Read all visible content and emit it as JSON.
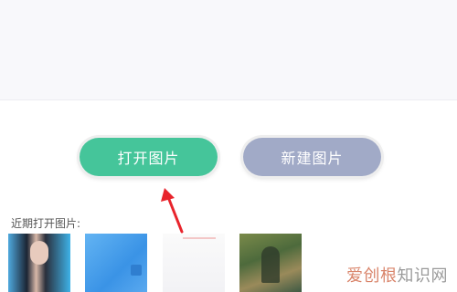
{
  "buttons": {
    "open_image": "打开图片",
    "new_image": "新建图片"
  },
  "recent": {
    "label": "近期打开图片:"
  },
  "watermark": {
    "accent": "爱创根",
    "rest": "知识网"
  },
  "colors": {
    "open_button": "#45c59a",
    "new_button": "#a1aac7",
    "arrow": "#e8242c"
  }
}
